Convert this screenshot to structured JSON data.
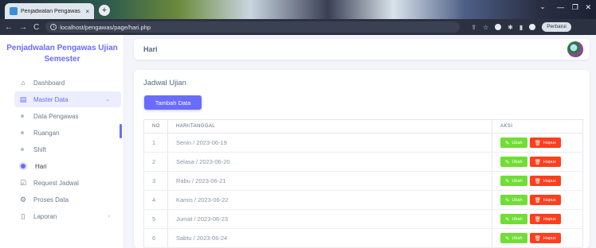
{
  "browser": {
    "tab_title": "Penjadwalan Pengawas",
    "tab_close": "×",
    "new_tab": "+",
    "url": "localhost/pengawas/page/hari.php",
    "profile_label": "Perbarui",
    "nav_back": "←",
    "nav_forward": "→",
    "nav_reload": "C"
  },
  "sidebar": {
    "brand": "Penjadwalan Pengawas Ujian Semester",
    "items": [
      {
        "label": "Dashboard",
        "icon": "home-icon"
      },
      {
        "label": "Master Data",
        "icon": "layout-icon"
      },
      {
        "label": "Data Pengawas"
      },
      {
        "label": "Ruangan"
      },
      {
        "label": "Shift"
      },
      {
        "label": "Hari"
      },
      {
        "label": "Request Jadwal",
        "icon": "check-square-icon"
      },
      {
        "label": "Proses Data",
        "icon": "gear-icon"
      },
      {
        "label": "Laporan",
        "icon": "file-icon"
      }
    ]
  },
  "header": {
    "title": "Hari"
  },
  "card": {
    "title": "Jadwal Ujian",
    "add_button": "Tambah Data"
  },
  "table": {
    "columns": [
      "NO",
      "HARI/TANGGAL",
      "AKSI"
    ],
    "rows": [
      {
        "no": "1",
        "day": "Senin / 2023-06-19"
      },
      {
        "no": "2",
        "day": "Selasa / 2023-06-20"
      },
      {
        "no": "3",
        "day": "Rabu / 2023-06-21"
      },
      {
        "no": "4",
        "day": "Kamis / 2023-06-22"
      },
      {
        "no": "5",
        "day": "Jumat / 2023-06-23"
      },
      {
        "no": "6",
        "day": "Sabtu / 2023-06-24"
      }
    ],
    "edit_label": "Ubah",
    "delete_label": "Hapus"
  },
  "colors": {
    "primary": "#696cff",
    "success": "#71dd37",
    "danger": "#ff3e1d"
  }
}
